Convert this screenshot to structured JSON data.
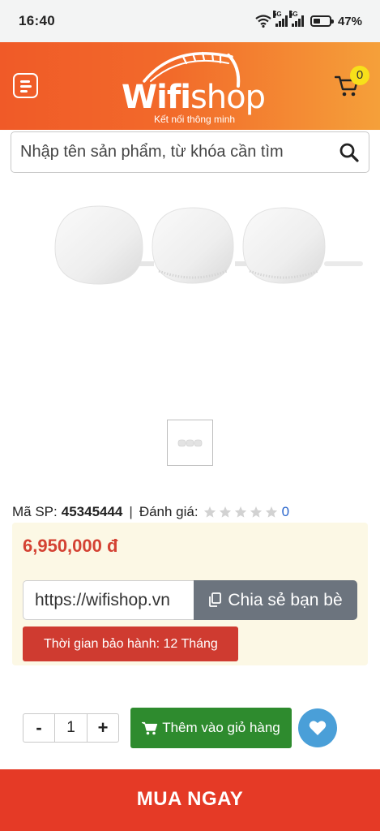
{
  "status_bar": {
    "time": "16:40",
    "network": "5G",
    "battery": "47%",
    "battery_level": 0.47
  },
  "header": {
    "menu_icon": "menu-icon",
    "logo": {
      "brand_bold": "Wifi",
      "brand_light": "shop",
      "tagline": "Kết nối thông minh"
    },
    "cart_icon": "cart-icon",
    "cart_count": "0"
  },
  "search": {
    "placeholder": "Nhập tên sản phẩm, từ khóa cần tìm",
    "value": "",
    "icon": "search-icon"
  },
  "product": {
    "sku_label": "Mã SP:",
    "sku": "45345444",
    "separator": "|",
    "rating_label": "Đánh giá:",
    "rating_stars": 0,
    "rating_max": 5,
    "rating_count": "0",
    "price": "6,950,000 đ",
    "share_url": "https://wifishop.vn",
    "share_label": "Chia sẻ bạn bè",
    "warranty": "Thời gian bảo hành: 12 Tháng"
  },
  "purchase": {
    "minus": "-",
    "quantity": "1",
    "plus": "+",
    "add_to_cart": "Thêm vào giỏ hàng",
    "buy_now": "MUA NGAY"
  },
  "colors": {
    "header_start": "#f05a28",
    "header_end": "#f5a03a",
    "price": "#d44233",
    "share_button": "#6c747e",
    "warranty": "#cf3b30",
    "add_to_cart": "#2e8b2e",
    "wishlist": "#4a9fd8",
    "buy_now": "#e53a26",
    "info_box": "#fcf8e5"
  }
}
